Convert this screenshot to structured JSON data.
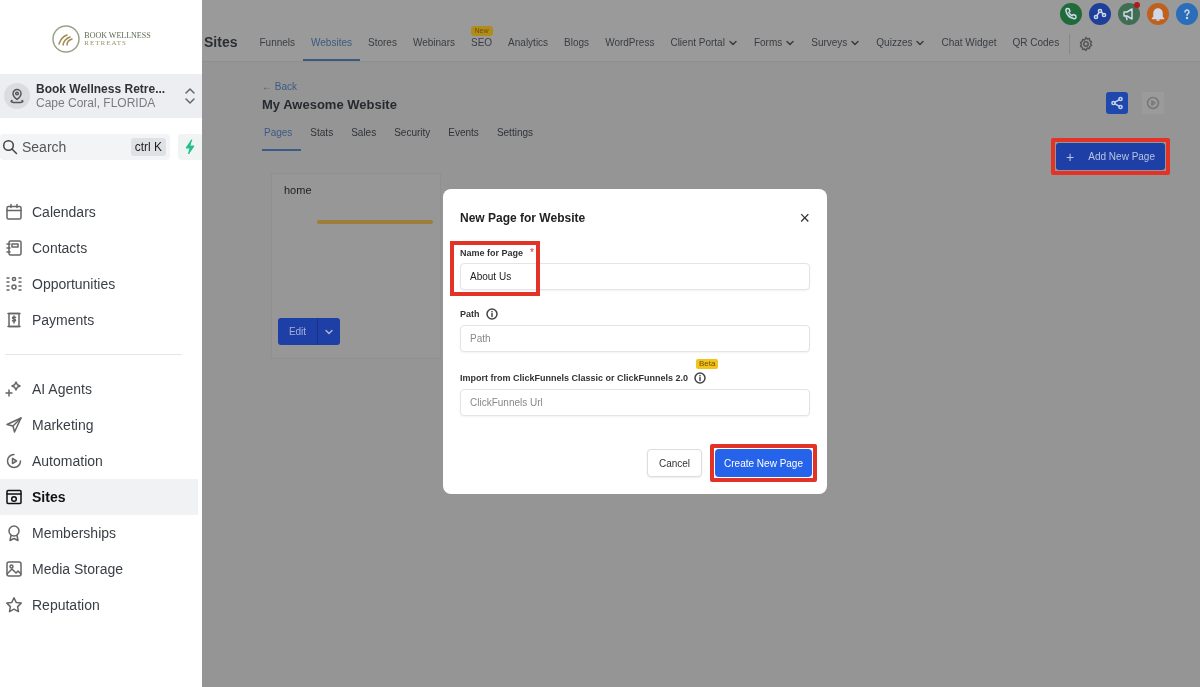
{
  "sidebar": {
    "logo": {
      "line_1": "BOOK WELLNESS",
      "line_2": "RETREATS"
    },
    "account": {
      "name": "Book Wellness Retre...",
      "location": "Cape Coral, FLORIDA"
    },
    "search": {
      "placeholder": "Search",
      "shortcut": "ctrl K"
    },
    "groups": [
      [
        {
          "label": "Calendars",
          "selected": false
        },
        {
          "label": "Contacts",
          "selected": false
        },
        {
          "label": "Opportunities",
          "selected": false
        },
        {
          "label": "Payments",
          "selected": false
        }
      ],
      [
        {
          "label": "AI Agents",
          "selected": false
        },
        {
          "label": "Marketing",
          "selected": false
        },
        {
          "label": "Automation",
          "selected": false
        },
        {
          "label": "Sites",
          "selected": true
        },
        {
          "label": "Memberships",
          "selected": false
        },
        {
          "label": "Media Storage",
          "selected": false
        },
        {
          "label": "Reputation",
          "selected": false
        }
      ]
    ]
  },
  "header_icons": [
    {
      "color": "#1f6b3a",
      "dot": false
    },
    {
      "color": "#1d3f9a",
      "dot": false
    },
    {
      "color": "#3f6e52",
      "dot": true
    },
    {
      "color": "#c0601d",
      "dot": false
    },
    {
      "color": "#2a6db8",
      "dot": false
    }
  ],
  "top_nav": {
    "title": "Sites",
    "tabs": [
      {
        "label": "Funnels",
        "selected": false
      },
      {
        "label": "Websites",
        "selected": true
      },
      {
        "label": "Stores",
        "selected": false
      },
      {
        "label": "Webinars",
        "selected": false
      },
      {
        "label": "SEO",
        "selected": false,
        "badge": "New"
      },
      {
        "label": "Analytics",
        "selected": false
      },
      {
        "label": "Blogs",
        "selected": false
      },
      {
        "label": "WordPress",
        "selected": false
      },
      {
        "label": "Client Portal",
        "selected": false,
        "dropdown": true
      },
      {
        "label": "Forms",
        "selected": false,
        "dropdown": true
      },
      {
        "label": "Surveys",
        "selected": false,
        "dropdown": true
      },
      {
        "label": "Quizzes",
        "selected": false,
        "dropdown": true
      },
      {
        "label": "Chat Widget",
        "selected": false
      },
      {
        "label": "QR Codes",
        "selected": false
      }
    ]
  },
  "website": {
    "back": "← Back",
    "title": "My Awesome Website",
    "tabs": [
      {
        "label": "Pages",
        "selected": true
      },
      {
        "label": "Stats",
        "selected": false
      },
      {
        "label": "Sales",
        "selected": false
      },
      {
        "label": "Security",
        "selected": false
      },
      {
        "label": "Events",
        "selected": false
      },
      {
        "label": "Settings",
        "selected": false
      }
    ],
    "add_button": {
      "label": "Add New Page",
      "icon": "+",
      "highlighted": true
    },
    "pages": [
      {
        "name": "home",
        "edit_label": "Edit"
      }
    ]
  },
  "dialog": {
    "title": "New Page for Website",
    "close": "×",
    "fields": [
      {
        "label": "Name for Page",
        "required_mark": "*",
        "value": "About Us",
        "highlighted": true,
        "info": false
      },
      {
        "label": "Path",
        "placeholder": "Path",
        "info": true
      },
      {
        "label": "Import from ClickFunnels Classic or ClickFunnels 2.0",
        "placeholder": "ClickFunnels Url",
        "info": true,
        "badge": "Beta"
      }
    ],
    "buttons": [
      {
        "label": "Cancel",
        "kind": "secondary",
        "highlighted": false
      },
      {
        "label": "Create New Page",
        "kind": "primary",
        "highlighted": true
      }
    ]
  }
}
